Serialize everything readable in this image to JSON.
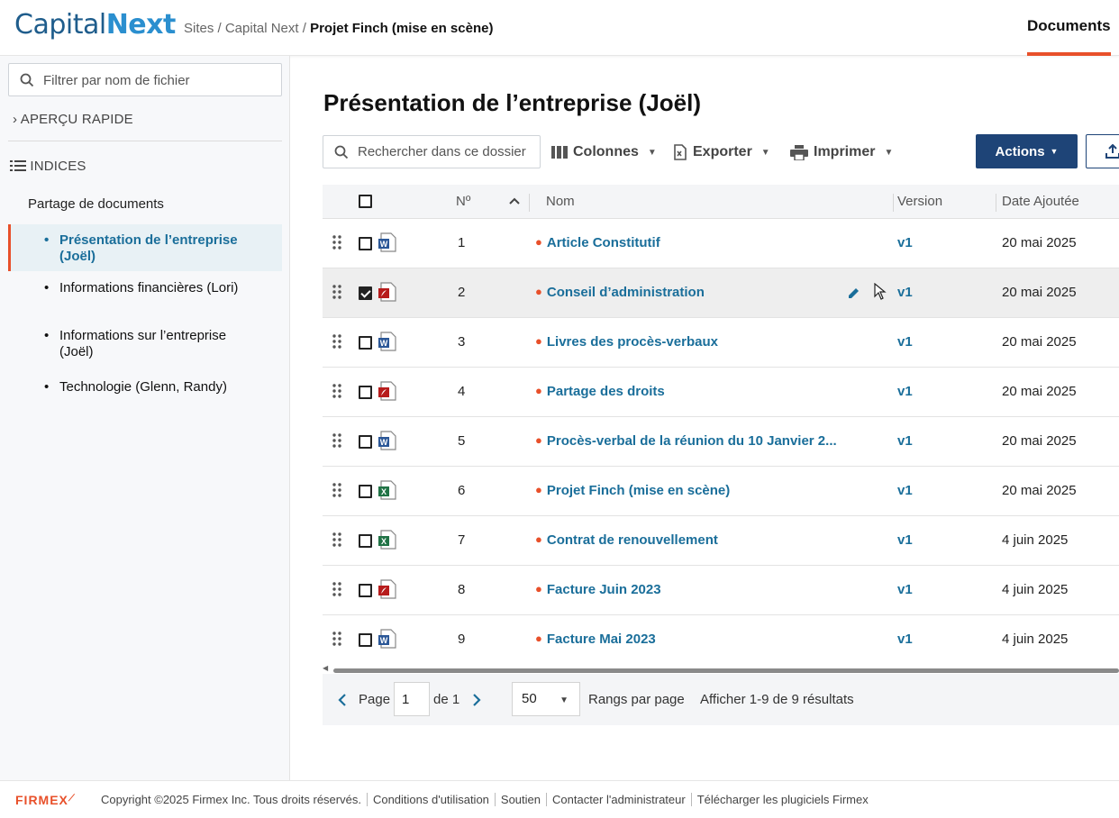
{
  "header": {
    "logo_part1": "Capital",
    "logo_part2": "Next",
    "breadcrumb_prefix": "Sites / Capital Next / ",
    "breadcrumb_current": "Projet Finch (mise en scène)",
    "nav_documents": "Documents",
    "accent_color": "#e8502a"
  },
  "sidebar": {
    "filter_placeholder": "Filtrer par nom de fichier",
    "quick_view": "APERÇU RAPIDE",
    "indices": "INDICES",
    "root": "Partage de documents",
    "items": [
      {
        "label": "Présentation de l’entreprise (Joël)",
        "active": true
      },
      {
        "label": "Informations financières (Lori)",
        "active": false
      },
      {
        "label": "Informations sur l’entreprise (Joël)",
        "active": false
      },
      {
        "label": "Technologie (Glenn, Randy)",
        "active": false
      }
    ]
  },
  "main": {
    "title": "Présentation de l’entreprise (Joël)",
    "search_placeholder": "Rechercher dans ce dossier",
    "toolbar": {
      "columns": "Colonnes",
      "export": "Exporter",
      "print": "Imprimer",
      "actions": "Actions"
    },
    "columns": {
      "num": "Nº",
      "name": "Nom",
      "version": "Version",
      "date": "Date Ajoutée"
    },
    "rows": [
      {
        "num": "1",
        "name": "Article Constitutif",
        "version": "v1",
        "date": "20 mai 2025",
        "type": "word",
        "selected": false
      },
      {
        "num": "2",
        "name": "Conseil d’administration",
        "version": "v1",
        "date": "20 mai 2025",
        "type": "pdf",
        "selected": true
      },
      {
        "num": "3",
        "name": "Livres des procès-verbaux",
        "version": "v1",
        "date": "20 mai 2025",
        "type": "word",
        "selected": false
      },
      {
        "num": "4",
        "name": "Partage des droits",
        "version": "v1",
        "date": "20 mai 2025",
        "type": "pdf",
        "selected": false
      },
      {
        "num": "5",
        "name": "Procès-verbal de la réunion du 10 Janvier 2...",
        "version": "v1",
        "date": "20 mai 2025",
        "type": "word",
        "selected": false
      },
      {
        "num": "6",
        "name": "Projet Finch (mise en scène)",
        "version": "v1",
        "date": "20 mai 2025",
        "type": "excel",
        "selected": false
      },
      {
        "num": "7",
        "name": "Contrat de renouvellement",
        "version": "v1",
        "date": "4 juin 2025",
        "type": "excel",
        "selected": false
      },
      {
        "num": "8",
        "name": "Facture Juin 2023",
        "version": "v1",
        "date": "4 juin 2025",
        "type": "pdf",
        "selected": false
      },
      {
        "num": "9",
        "name": "Facture Mai 2023",
        "version": "v1",
        "date": "4 juin 2025",
        "type": "word",
        "selected": false
      }
    ],
    "pagination": {
      "page_label": "Page",
      "page_value": "1",
      "of_label": "de 1",
      "per_page_value": "50",
      "per_page_label": "Rangs par page",
      "results": "Afficher 1-9 de 9 résultats"
    }
  },
  "footer": {
    "logo": "FIRMEX",
    "links": [
      "Copyright ©2025 Firmex Inc. Tous droits réservés.",
      "Conditions d'utilisation",
      "Soutien",
      "Contacter l'administrateur",
      "Télécharger les plugiciels Firmex"
    ]
  }
}
